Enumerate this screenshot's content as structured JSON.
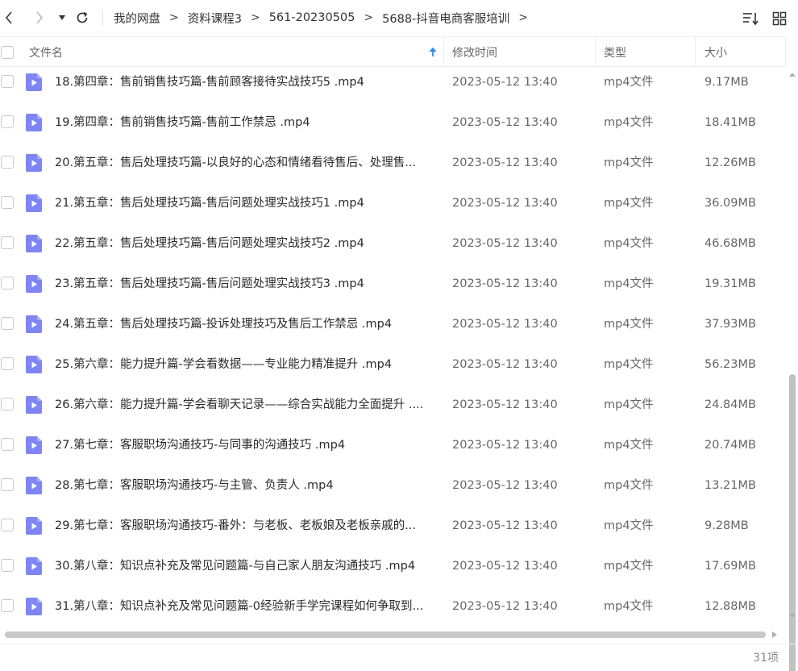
{
  "breadcrumb": [
    "我的网盘",
    "资料课程3",
    "561-20230505",
    "5688-抖音电商客服培训"
  ],
  "breadcrumb_separator": ">",
  "columns": {
    "name": "文件名",
    "modified": "修改时间",
    "type": "类型",
    "size": "大小"
  },
  "sort": {
    "column": "name",
    "direction": "ascending",
    "indicator_color": "#2f8cf0"
  },
  "file_icon": {
    "name": "video-file-icon",
    "color": "#7f85f5"
  },
  "files": [
    {
      "name": "18.第四章：售前销售技巧篇-售前顾客接待实战技巧5 .mp4",
      "modified": "2023-05-12 13:40",
      "type": "mp4文件",
      "size": "9.17MB"
    },
    {
      "name": "19.第四章：售前销售技巧篇-售前工作禁忌 .mp4",
      "modified": "2023-05-12 13:40",
      "type": "mp4文件",
      "size": "18.41MB"
    },
    {
      "name": "20.第五章：售后处理技巧篇-以良好的心态和情绪看待售后、处理售...",
      "modified": "2023-05-12 13:40",
      "type": "mp4文件",
      "size": "12.26MB"
    },
    {
      "name": "21.第五章：售后处理技巧篇-售后问题处理实战技巧1 .mp4",
      "modified": "2023-05-12 13:40",
      "type": "mp4文件",
      "size": "36.09MB"
    },
    {
      "name": "22.第五章：售后处理技巧篇-售后问题处理实战技巧2 .mp4",
      "modified": "2023-05-12 13:40",
      "type": "mp4文件",
      "size": "46.68MB"
    },
    {
      "name": "23.第五章：售后处理技巧篇-售后问题处理实战技巧3 .mp4",
      "modified": "2023-05-12 13:40",
      "type": "mp4文件",
      "size": "19.31MB"
    },
    {
      "name": "24.第五章：售后处理技巧篇-投诉处理技巧及售后工作禁忌 .mp4",
      "modified": "2023-05-12 13:40",
      "type": "mp4文件",
      "size": "37.93MB"
    },
    {
      "name": "25.第六章：能力提升篇-学会看数据——专业能力精准提升 .mp4",
      "modified": "2023-05-12 13:40",
      "type": "mp4文件",
      "size": "56.23MB"
    },
    {
      "name": "26.第六章：能力提升篇-学会看聊天记录——综合实战能力全面提升 ....",
      "modified": "2023-05-12 13:40",
      "type": "mp4文件",
      "size": "24.84MB"
    },
    {
      "name": "27.第七章：客服职场沟通技巧-与同事的沟通技巧 .mp4",
      "modified": "2023-05-12 13:40",
      "type": "mp4文件",
      "size": "20.74MB"
    },
    {
      "name": "28.第七章：客服职场沟通技巧-与主管、负责人 .mp4",
      "modified": "2023-05-12 13:40",
      "type": "mp4文件",
      "size": "13.21MB"
    },
    {
      "name": "29.第七章：客服职场沟通技巧-番外：与老板、老板娘及老板亲戚的...",
      "modified": "2023-05-12 13:40",
      "type": "mp4文件",
      "size": "9.28MB"
    },
    {
      "name": "30.第八章：知识点补充及常见问题篇-与自己家人朋友沟通技巧 .mp4",
      "modified": "2023-05-12 13:40",
      "type": "mp4文件",
      "size": "17.69MB"
    },
    {
      "name": "31.第八章：知识点补充及常见问题篇-0经验新手学完课程如何争取到...",
      "modified": "2023-05-12 13:40",
      "type": "mp4文件",
      "size": "12.88MB"
    }
  ],
  "item_count": "31项"
}
